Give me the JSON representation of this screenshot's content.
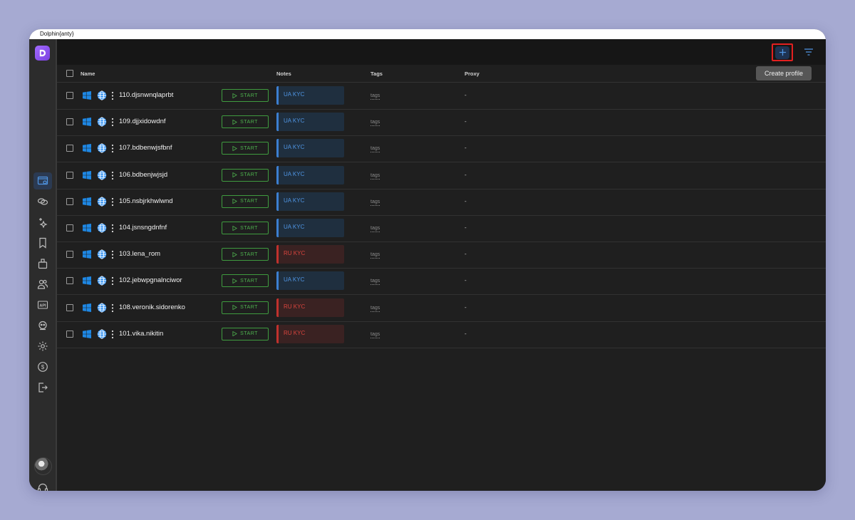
{
  "window": {
    "title": "Dolphin{anty}"
  },
  "sidebar": {
    "items": [
      {
        "icon": "browser-profiles-icon",
        "active": true
      },
      {
        "icon": "proxy-icon",
        "active": false
      },
      {
        "icon": "automation-icon",
        "active": false
      },
      {
        "icon": "bookmark-icon",
        "active": false
      },
      {
        "icon": "extensions-icon",
        "active": false
      },
      {
        "icon": "users-icon",
        "active": false
      },
      {
        "icon": "api-icon",
        "active": false
      },
      {
        "icon": "robot-icon",
        "active": false
      },
      {
        "icon": "gear-icon",
        "active": false
      },
      {
        "icon": "billing-icon",
        "active": false
      },
      {
        "icon": "logout-icon",
        "active": false
      }
    ],
    "bottom": [
      "avatar",
      "support-headset-icon"
    ]
  },
  "toolbar": {
    "add_tooltip": "Create profile"
  },
  "table": {
    "columns": {
      "name": "Name",
      "notes": "Notes",
      "tags": "Tags",
      "proxy": "Proxy"
    },
    "rows": [
      {
        "name": "110.djsnwnqlaprbt",
        "start": "START",
        "note": "UA KYC",
        "note_type": "ua",
        "tags": "tags",
        "proxy": "-"
      },
      {
        "name": "109.djjxidowdnf",
        "start": "START",
        "note": "UA KYC",
        "note_type": "ua",
        "tags": "tags",
        "proxy": "-"
      },
      {
        "name": "107.bdbenwjsfbnf",
        "start": "START",
        "note": "UA KYC",
        "note_type": "ua",
        "tags": "tags",
        "proxy": "-"
      },
      {
        "name": "106.bdbenjwjsjd",
        "start": "START",
        "note": "UA KYC",
        "note_type": "ua",
        "tags": "tags",
        "proxy": "-"
      },
      {
        "name": "105.nsbjrkhwlwnd",
        "start": "START",
        "note": "UA KYC",
        "note_type": "ua",
        "tags": "tags",
        "proxy": "-"
      },
      {
        "name": "104.jsnsngdnfnf",
        "start": "START",
        "note": "UA KYC",
        "note_type": "ua",
        "tags": "tags",
        "proxy": "-"
      },
      {
        "name": "103.lena_rom",
        "start": "START",
        "note": "RU KYC",
        "note_type": "ru",
        "tags": "tags",
        "proxy": "-"
      },
      {
        "name": "102.jebwpgnalnciwor",
        "start": "START",
        "note": "UA KYC",
        "note_type": "ua",
        "tags": "tags",
        "proxy": "-"
      },
      {
        "name": "108.veronik.sidorenko",
        "start": "START",
        "note": "RU KYC",
        "note_type": "ru",
        "tags": "tags",
        "proxy": "-"
      },
      {
        "name": "101.vika.nikitin",
        "start": "START",
        "note": "RU KYC",
        "note_type": "ru",
        "tags": "tags",
        "proxy": "-"
      }
    ]
  },
  "colors": {
    "accent": "#4f95e3",
    "start": "#4eb24e",
    "ru": "#d8443d",
    "highlight": "#e32020"
  }
}
